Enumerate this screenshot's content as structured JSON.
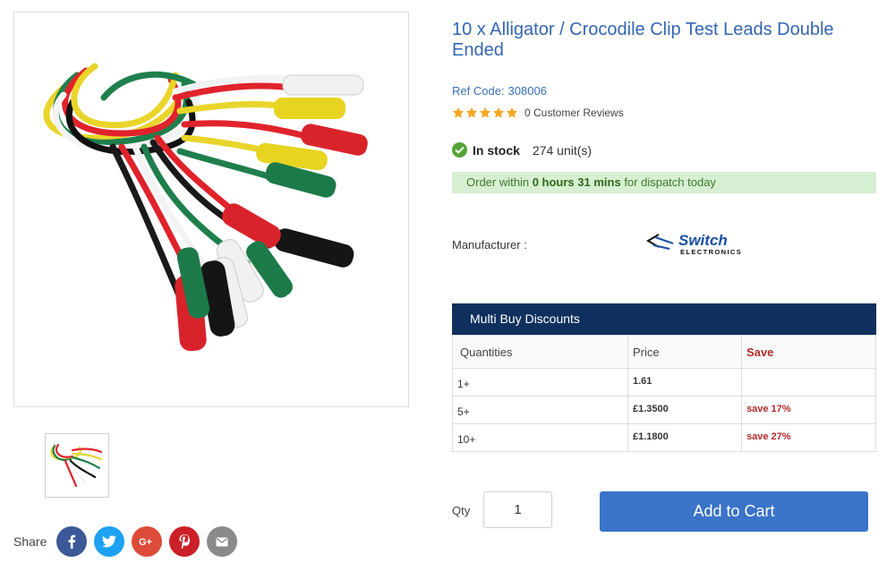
{
  "product": {
    "title": "10 x Alligator / Crocodile Clip Test Leads Double Ended",
    "ref_label": "Ref Code:",
    "ref_code": "308006",
    "rating_stars": 5,
    "reviews_text": "0 Customer Reviews",
    "stock_status": "In stock",
    "stock_units": "274 unit(s)",
    "dispatch": {
      "prefix": "Order within",
      "time": "0 hours 31 mins",
      "suffix": "for dispatch today"
    },
    "manufacturer_label": "Manufacturer :",
    "manufacturer_logo": {
      "name": "Switch",
      "sub": "ELECTRONICS"
    }
  },
  "multibuy": {
    "heading": "Multi Buy Discounts",
    "headers": {
      "quantities": "Quantities",
      "price": "Price",
      "save": "Save"
    },
    "rows": [
      {
        "qty": "1+",
        "price": "1.61",
        "save": ""
      },
      {
        "qty": "5+",
        "price": "£1.3500",
        "save": "save 17%"
      },
      {
        "qty": "10+",
        "price": "£1.1800",
        "save": "save 27%"
      }
    ]
  },
  "purchase": {
    "qty_label": "Qty",
    "qty_value": "1",
    "add_to_cart": "Add to Cart"
  },
  "share": {
    "label": "Share",
    "networks": [
      "facebook-icon",
      "twitter-icon",
      "google-plus-icon",
      "pinterest-icon",
      "email-icon"
    ],
    "colors": {
      "facebook": "#3b5998",
      "twitter": "#1da1f2",
      "google_plus": "#dd4b39",
      "pinterest": "#cb2027",
      "email": "#8a8a8a"
    }
  },
  "colors": {
    "title": "#3366b3",
    "accent_button": "#3a73c8",
    "header_bar": "#0f2f5e",
    "save_red": "#b22a2a",
    "stock_green": "#55a334",
    "dispatch_bg": "#d7efd2",
    "star": "#f5a623"
  }
}
